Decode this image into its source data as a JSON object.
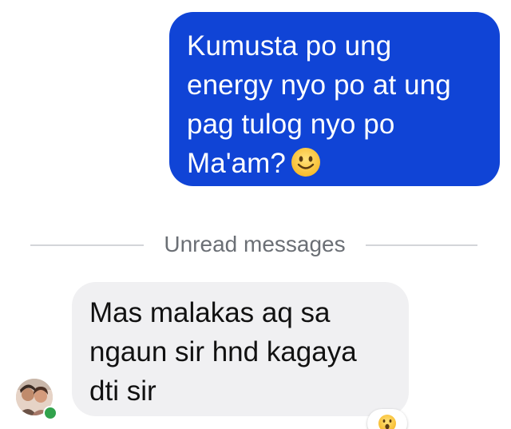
{
  "conversation": {
    "outgoing_message": {
      "lines": [
        "Kumusta po ung",
        "energy nyo po at ung",
        "pag tulog nyo po",
        "Ma'am?"
      ],
      "emoji": "slightly-smiling-face-icon",
      "bubble_color": "#1044d6"
    },
    "unread_divider": {
      "label": "Unread messages"
    },
    "incoming_message": {
      "lines": [
        "Mas malakas aq sa",
        "ngaun sir hnd kagaya",
        "dti sir"
      ],
      "bubble_color": "#f0f0f2",
      "reaction": "surprised-face-icon"
    },
    "sender": {
      "avatar": "avatar-photo",
      "online": true,
      "presence_color": "#31a24c"
    }
  }
}
